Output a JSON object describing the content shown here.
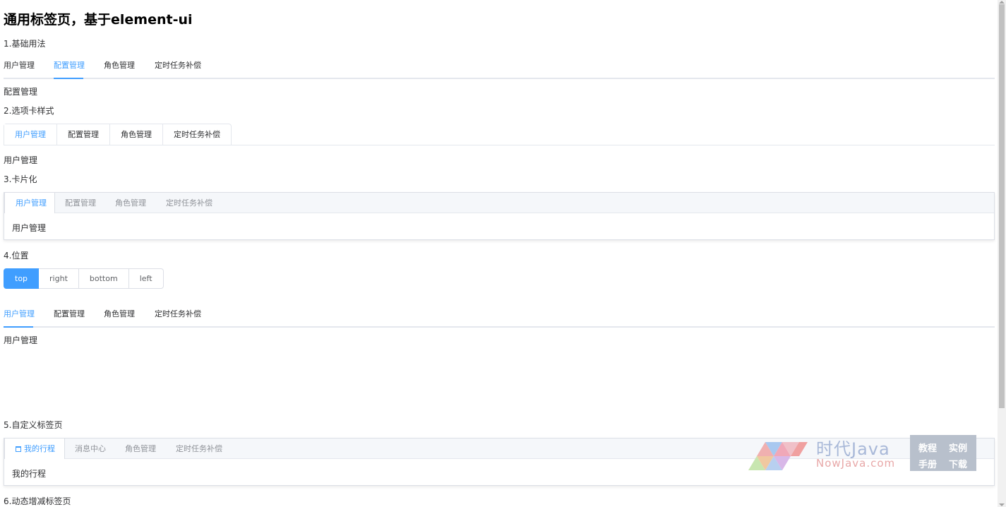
{
  "title": "通用标签页，基于element-ui",
  "sections": {
    "s1": "1.基础用法",
    "s2": "2.选项卡样式",
    "s3": "3.卡片化",
    "s4": "4.位置",
    "s5": "5.自定义标签页",
    "s6": "6.动态增减标签页"
  },
  "tabs1": {
    "items": [
      "用户管理",
      "配置管理",
      "角色管理",
      "定时任务补偿"
    ],
    "active": "配置管理",
    "content": "配置管理"
  },
  "tabs2": {
    "items": [
      "用户管理",
      "配置管理",
      "角色管理",
      "定时任务补偿"
    ],
    "active": "用户管理",
    "content": "用户管理"
  },
  "tabs3": {
    "items": [
      "用户管理",
      "配置管理",
      "角色管理",
      "定时任务补偿"
    ],
    "active": "用户管理",
    "content": "用户管理"
  },
  "position": {
    "options": [
      "top",
      "right",
      "bottom",
      "left"
    ],
    "selected": "top",
    "tabs": [
      "用户管理",
      "配置管理",
      "角色管理",
      "定时任务补偿"
    ],
    "active": "用户管理",
    "content": "用户管理"
  },
  "tabs5": {
    "items": [
      "我的行程",
      "消息中心",
      "角色管理",
      "定时任务补偿"
    ],
    "first_icon": "calendar-icon",
    "active": "我的行程",
    "content": "我的行程"
  },
  "watermark": {
    "brand": "时代Java",
    "site": "NowJava.com",
    "links": [
      "教程",
      "实例",
      "手册",
      "下载"
    ]
  },
  "colors": {
    "accent": "#409eff",
    "text": "#303133",
    "muted": "#909399",
    "border": "#e4e7ed"
  }
}
